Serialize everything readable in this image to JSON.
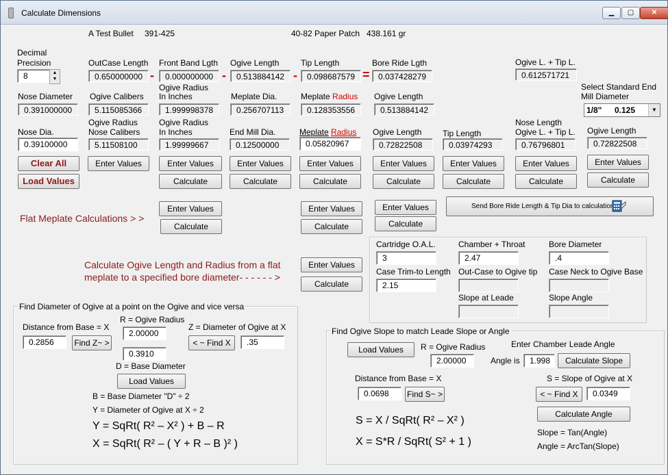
{
  "window": {
    "title": "Calculate Dimensions",
    "minimize": "▁",
    "maximize": "▢",
    "close": "✕"
  },
  "header": {
    "bullet_name": "A Test Bullet",
    "bullet_code": "391-425",
    "patch_name": "40-82 Paper Patch",
    "patch_weight": "438.161 gr"
  },
  "precision": {
    "label_line1": "Decimal",
    "label_line2": "Precision",
    "value": "8"
  },
  "row1": {
    "outcase_label": "OutCase Length",
    "outcase_value": "0.650000000",
    "frontband_label": "Front Band Lgth",
    "frontband_value": "0.000000000",
    "ogive_label": "Ogive Length",
    "ogive_value": "0.513884142",
    "tip_label": "Tip Length",
    "tip_value": "0.098687579",
    "boreride_label": "Bore Ride Lgth",
    "boreride_value": "0.037428279",
    "ogive_tip_label": "Ogive L. + Tip L.",
    "ogive_tip_value": "0.612571721",
    "op_minus": "-",
    "op_equals": "="
  },
  "endmill": {
    "label_line1": "Select Standard End",
    "label_line2": "Mill Diameter",
    "fraction": "1/8\"",
    "decimal": "0.125"
  },
  "row2": {
    "nose_label": "Nose Diameter",
    "nose_value": "0.391000000",
    "calibers_label": "Ogive Calibers",
    "calibers_value": "5.115085366",
    "radius_label1": "Ogive Radius",
    "radius_label2": "In Inches",
    "radius_value": "1.999998378",
    "meplate_label": "Meplate Dia.",
    "meplate_value": "0.256707113",
    "mradius_label1": "Meplate",
    "mradius_label2": "Radius",
    "mradius_value": "0.128353556",
    "ogive_label": "Ogive Length",
    "ogive_value": "0.513884142"
  },
  "row3": {
    "nose_label": "Nose Dia.",
    "nose_value": "0.39100000",
    "calibers_label1": "Ogive Radius",
    "calibers_label2": "Nose Calibers",
    "calibers_value": "5.11508100",
    "radius_label1": "Ogive Radius",
    "radius_label2": "In Inches",
    "radius_value": "1.99999667",
    "endmill_label": "End Mill Dia.",
    "endmill_value": "0.12500000",
    "mradius_label1": "Meplate",
    "mradius_label2": "Radius",
    "mradius_value": "0.05820967",
    "ogive_label": "Ogive Length",
    "ogive_value": "0.72822508",
    "tip_label": "Tip Length",
    "tip_value": "0.03974293",
    "nosel_label1": "Nose Length",
    "nosel_label2": "Ogive L. + Tip L.",
    "nosel_value": "0.76796801",
    "ogive2_label": "Ogive Length",
    "ogive2_value": "0.72822508"
  },
  "buttons": {
    "clear_all": "Clear All",
    "load_values": "Load Values",
    "enter_values": "Enter Values",
    "calculate": "Calculate",
    "send": "Send Bore Ride Length & Tip Dia to calculations"
  },
  "flat": {
    "label": "Flat Meplate Calculations > >"
  },
  "calc_ogive": {
    "line1": "Calculate Ogive Length and Radius from  a flat",
    "line2": "meplate to a specified  bore diameter- - - - - - >"
  },
  "chamber": {
    "oal_label": "Cartridge O.A.L.",
    "oal_value": "3",
    "throat_label": "Chamber + Throat",
    "throat_value": "2.47",
    "bore_label": "Bore Diameter",
    "bore_value": ".4",
    "trim_label": "Case Trim-to Length",
    "trim_value": "2.15",
    "outcase_label": "Out-Case to Ogive tip",
    "outcase_value": "",
    "neck_label": "Case Neck to Ogive Base",
    "neck_value": "",
    "slope_leade_label": "Slope at Leade",
    "slope_leade_value": "",
    "slope_angle_label": "Slope Angle",
    "slope_angle_value": ""
  },
  "diameter_group": {
    "title": "Find Diameter of Ogive at a point on the Ogive and vice versa",
    "distance_label": "Distance from Base = X",
    "distance_value": "0.2856",
    "find_z": "Find Z~ >",
    "r_label": "R = Ogive Radius",
    "r_value": "2.00000",
    "z_label": "Z = Diameter of Ogive at X",
    "find_x": "< ~ Find X",
    "z_value": ".35",
    "d_value": "0.3910",
    "d_label": "D = Base Diameter",
    "load_values": "Load Values",
    "b_def": "B = Base Diameter  \"D\"  ÷ 2",
    "y_def": "Y = Diameter of Ogive at X ÷ 2",
    "formula1": "Y =   SqRt( R² –  X² )   + B – R",
    "formula2": "X =   SqRt( R² – (  Y + R – B )² )"
  },
  "slope_group": {
    "title": "Find Ogive Slope to match Leade Slope or Angle",
    "load_values": "Load Values",
    "r_label": "R = Ogive Radius",
    "r_value": "2.00000",
    "enter_angle": "Enter Chamber Leade Angle",
    "angle_is": "Angle is",
    "angle_value": "1.998",
    "calc_slope": "Calculate Slope",
    "distance_label": "Distance from Base = X",
    "distance_value": "0.0698",
    "find_s": "Find S~ >",
    "s_label": "S = Slope of Ogive at X",
    "find_x": "< ~ Find X",
    "s_value": "0.0349",
    "calc_angle": "Calculate Angle",
    "formula1": "S =   X   / SqRt( R² –   X² )",
    "formula2": "X =   S*R /  SqRt( S²  + 1 )",
    "slope_def": "Slope = Tan(Angle)",
    "angle_def": "Angle = ArcTan(Slope)"
  }
}
